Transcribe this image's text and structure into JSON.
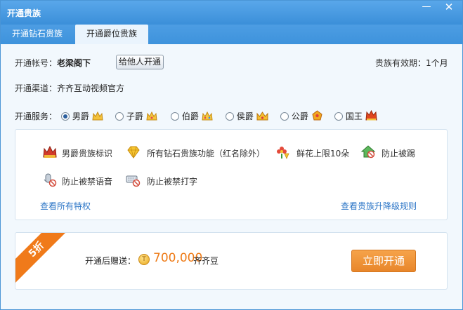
{
  "window": {
    "title": "开通贵族",
    "minimize_glyph": "—",
    "close_glyph": "✕"
  },
  "tabs": [
    {
      "label": "开通钻石贵族",
      "active": false
    },
    {
      "label": "开通爵位贵族",
      "active": true
    }
  ],
  "account": {
    "label": "开通帐号：",
    "value": "老梁阁下",
    "gift_button": "给他人开通",
    "validity_label": "贵族有效期：",
    "validity_value": "1个月"
  },
  "channel": {
    "label": "开通渠道：",
    "value": "齐齐互动视频官方"
  },
  "service": {
    "label": "开通服务：",
    "options": [
      {
        "label": "男爵",
        "selected": true,
        "icon": "baron-crown-icon"
      },
      {
        "label": "子爵",
        "selected": false,
        "icon": "viscount-crown-icon"
      },
      {
        "label": "伯爵",
        "selected": false,
        "icon": "earl-crown-icon"
      },
      {
        "label": "侯爵",
        "selected": false,
        "icon": "marquis-crown-icon"
      },
      {
        "label": "公爵",
        "selected": false,
        "icon": "duke-crown-icon"
      },
      {
        "label": "国王",
        "selected": false,
        "icon": "king-crown-icon"
      }
    ]
  },
  "privileges": {
    "items": [
      {
        "label": "男爵贵族标识",
        "icon": "crown-badge-icon"
      },
      {
        "label": "所有钻石贵族功能（红名除外）",
        "icon": "diamond-icon"
      },
      {
        "label": "鲜花上限10朵",
        "icon": "flower-icon"
      },
      {
        "label": "防止被踢",
        "icon": "house-shield-icon"
      },
      {
        "label": "防止被禁语音",
        "icon": "mic-shield-icon"
      },
      {
        "label": "防止被禁打字",
        "icon": "keyboard-shield-icon"
      }
    ],
    "view_all_link": "查看所有特权",
    "rules_link": "查看贵族升降级规则"
  },
  "offer": {
    "discount_badge": "5折",
    "gift_label": "开通后赠送：",
    "coin_glyph": "T",
    "amount": "700,000",
    "amount_unit": "齐齐豆",
    "open_button": "立即开通"
  },
  "colors": {
    "titlebar": "#3b8fd9",
    "accent_orange": "#ee7a16",
    "link": "#2a74c6"
  }
}
